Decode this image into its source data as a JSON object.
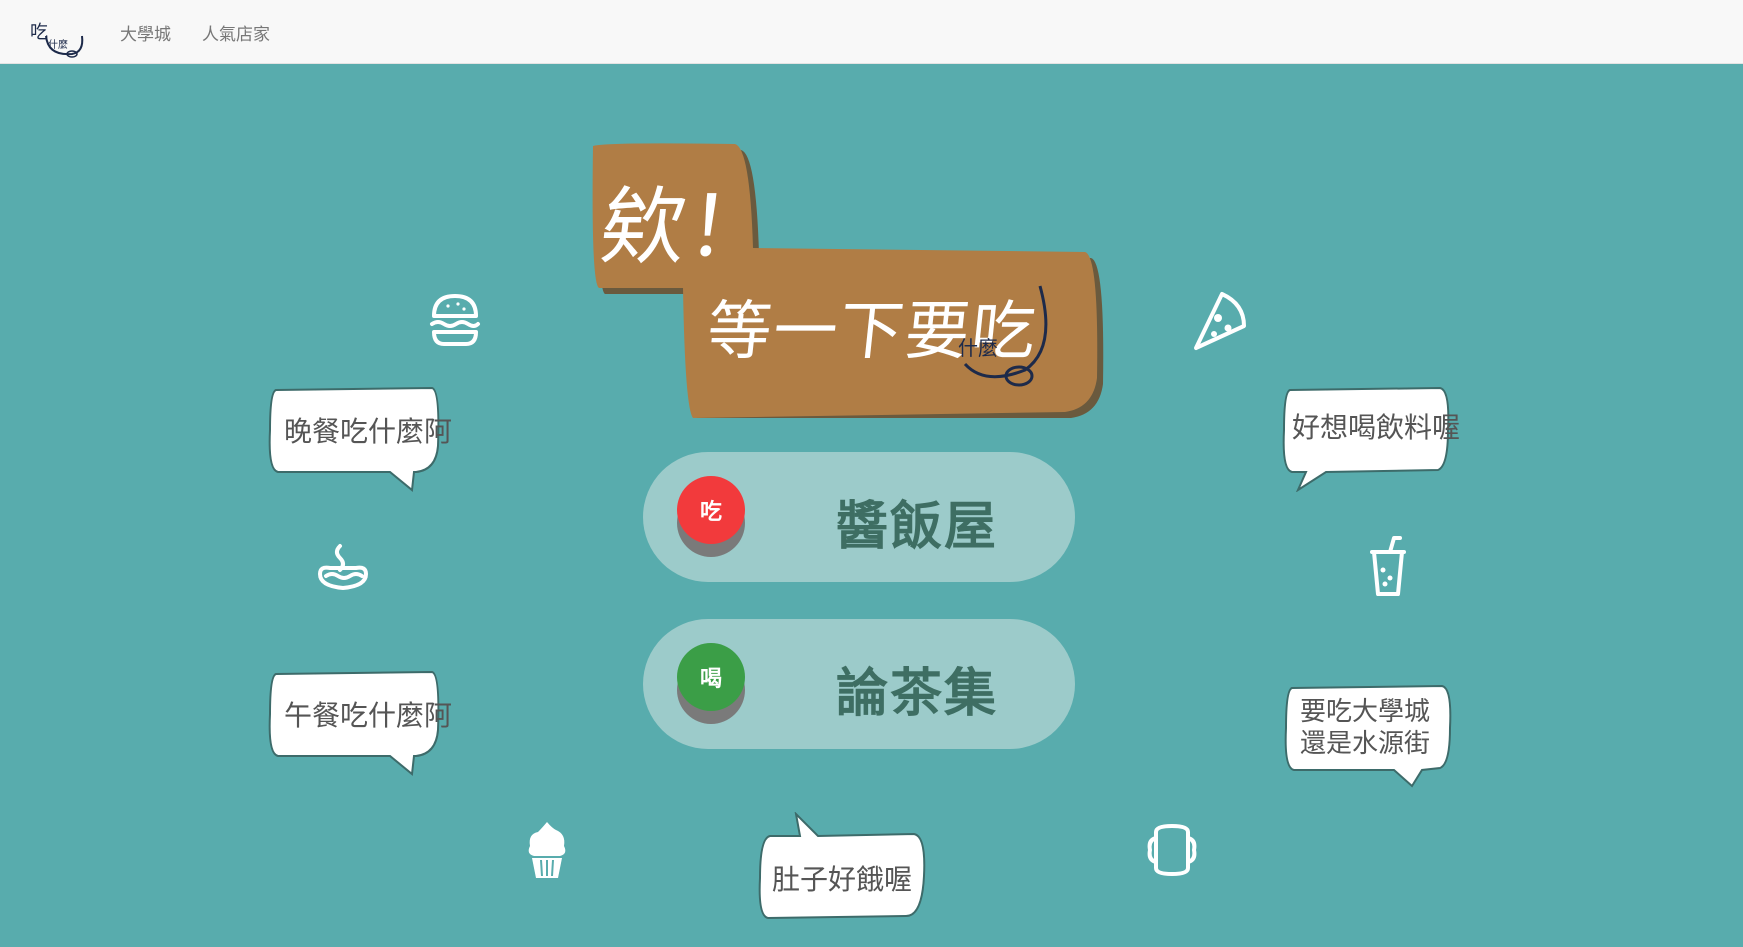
{
  "navbar": {
    "logo_alt": "吃什麼",
    "links": [
      "大學城",
      "人氣店家"
    ]
  },
  "hero": {
    "line1": "欸！",
    "line2": "等一下要吃",
    "line2_sub": "什麼"
  },
  "buttons": [
    {
      "badge": "吃",
      "label": "醬飯屋",
      "badge_color": "#f23a3c"
    },
    {
      "badge": "喝",
      "label": "論茶集",
      "badge_color": "#3b9e47"
    }
  ],
  "bubbles": {
    "dinner": "晚餐吃什麼阿",
    "lunch": "午餐吃什麼阿",
    "hungry": "肚子好餓喔",
    "drink": "好想喝飲料喔",
    "where_line1": "要吃大學城",
    "where_line2": "還是水源街"
  },
  "icons": [
    "burger-icon",
    "pizza-icon",
    "hotdog-icon",
    "drink-cup-icon",
    "cupcake-icon",
    "sandwich-icon"
  ],
  "colors": {
    "background": "#58acad",
    "sign": "#b07d45",
    "pill": "#9ccbca",
    "pill_text": "#3e6e63"
  }
}
